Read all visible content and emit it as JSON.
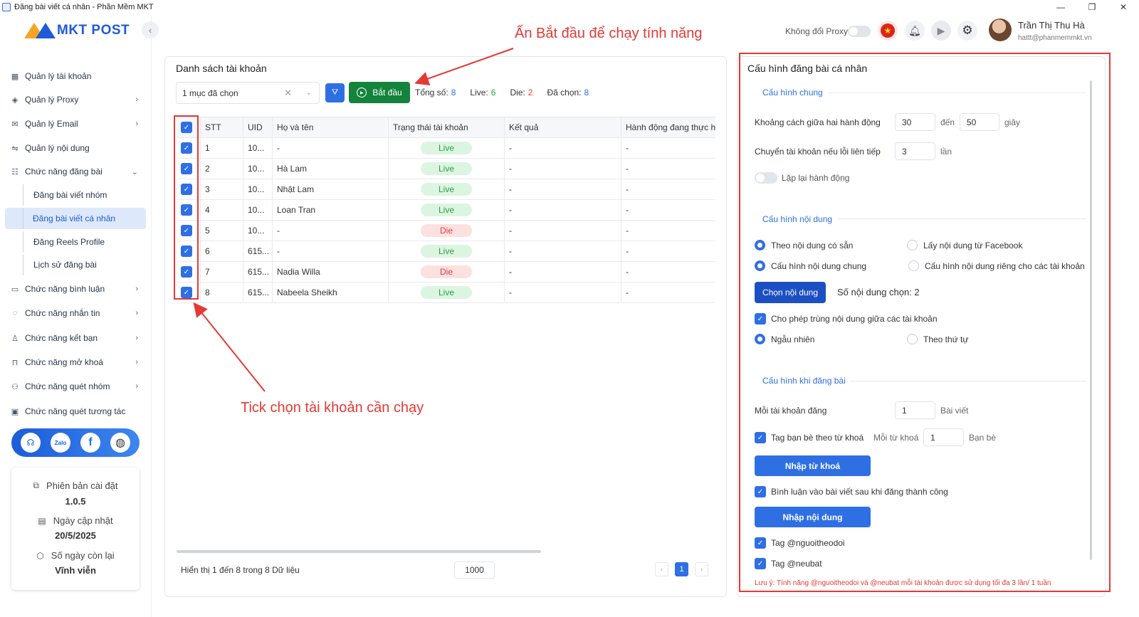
{
  "window": {
    "title": "Đăng bài viết cá nhân - Phần Mềm MKT",
    "minimize": "—",
    "restore": "❐",
    "close": "✕"
  },
  "logo": {
    "text": "MKT POST"
  },
  "sidebar": {
    "items": [
      {
        "label": "Quản lý tài khoản",
        "icon": "grid-icon"
      },
      {
        "label": "Quản lý Proxy",
        "icon": "layers-icon"
      },
      {
        "label": "Quản lý Email",
        "icon": "mail-icon"
      },
      {
        "label": "Quản lý nội dung",
        "icon": "content-icon"
      },
      {
        "label": "Chức năng đăng bài",
        "icon": "post-icon"
      },
      {
        "label": "Chức năng bình luận",
        "icon": "comment-icon"
      },
      {
        "label": "Chức năng nhắn tin",
        "icon": "message-icon"
      },
      {
        "label": "Chức năng kết bạn",
        "icon": "add-friend-icon"
      },
      {
        "label": "Chức năng mở khoá",
        "icon": "lock-icon"
      },
      {
        "label": "Chức năng quét nhóm",
        "icon": "group-icon"
      },
      {
        "label": "Chức năng quét tương tác",
        "icon": "scan-icon"
      }
    ],
    "subitems": [
      "Đăng bài viết nhóm",
      "Đăng bài viết cá nhân",
      "Đăng Reels Profile",
      "Lịch sử đăng bài"
    ],
    "social": {
      "zalo": "Zalo",
      "facebook": "f"
    }
  },
  "info": {
    "version_label": "Phiên bản cài đặt",
    "version": "1.0.5",
    "update_label": "Ngày cập nhật",
    "update": "20/5/2025",
    "days_label": "Số ngày còn lại",
    "days": "Vĩnh viễn"
  },
  "topbar": {
    "proxy_label": "Không đổi Proxy",
    "user_name": "Trần Thị Thu Hà",
    "user_email": "hattt@phanmemmkt.vn"
  },
  "accounts": {
    "title": "Danh sách tài khoản",
    "select_value": "1 mục đã chọn",
    "start_label": "Bắt đầu",
    "stats": {
      "total_label": "Tổng số:",
      "total": "8",
      "live_label": "Live:",
      "live": "6",
      "die_label": "Die:",
      "die": "2",
      "selected_label": "Đã chọn:",
      "selected": "8"
    },
    "columns": [
      "STT",
      "UID",
      "Họ và tên",
      "Trạng thái tài khoản",
      "Kết quả",
      "Hành động đang thực h"
    ],
    "rows": [
      {
        "stt": "1",
        "uid": "10...",
        "name": "-",
        "status": "Live",
        "result": "-",
        "action": "-"
      },
      {
        "stt": "2",
        "uid": "10...",
        "name": "Hà Lam",
        "status": "Live",
        "result": "-",
        "action": "-"
      },
      {
        "stt": "3",
        "uid": "10...",
        "name": "Nhật Lam",
        "status": "Live",
        "result": "-",
        "action": "-"
      },
      {
        "stt": "4",
        "uid": "10...",
        "name": "Loan Tran",
        "status": "Live",
        "result": "-",
        "action": "-"
      },
      {
        "stt": "5",
        "uid": "10...",
        "name": "-",
        "status": "Die",
        "result": "-",
        "action": "-"
      },
      {
        "stt": "6",
        "uid": "615...",
        "name": "-",
        "status": "Live",
        "result": "-",
        "action": "-"
      },
      {
        "stt": "7",
        "uid": "615...",
        "name": "Nadia Willa",
        "status": "Die",
        "result": "-",
        "action": "-"
      },
      {
        "stt": "8",
        "uid": "615...",
        "name": "Nabeela Sheikh",
        "status": "Live",
        "result": "-",
        "action": "-"
      }
    ],
    "footer": "Hiển thị 1 đến 8 trong 8 Dữ liệu",
    "page_size": "1000",
    "page": "1",
    "prev": "‹",
    "next": "›"
  },
  "config": {
    "title": "Cấu hình đăng bài cá nhân",
    "general": {
      "title": "Cấu hình chung",
      "delay_label": "Khoảng cách giữa hai hành động",
      "delay_from": "30",
      "to_label": "đến",
      "delay_to": "50",
      "sec_label": "giây",
      "switch_label": "Chuyển tài khoản nếu lỗi liên tiếp",
      "switch_value": "3",
      "times_label": "lần",
      "repeat_label": "Lặp lại hành động"
    },
    "content": {
      "title": "Cấu hình nội dung",
      "opt_available": "Theo nội dung có sẵn",
      "opt_facebook": "Lấy nội dung từ Facebook",
      "opt_common": "Cấu hình nội dung chung",
      "opt_separate": "Cấu hình nội dung riêng cho các tài khoản",
      "choose_btn": "Chọn nội dung",
      "chosen_count": "Số nội dung chọn: 2",
      "allow_dup": "Cho phép trùng nội dung giữa các tài khoản",
      "opt_random": "Ngẫu nhiên",
      "opt_order": "Theo thứ tự"
    },
    "posting": {
      "title": "Cấu hình khi đăng bài",
      "per_account_label": "Mỗi tài khoản đăng",
      "per_account": "1",
      "posts_label": "Bài viết",
      "tag_friends": "Tag bạn bè theo từ khoá",
      "per_keyword_label": "Mỗi từ khoá",
      "per_keyword": "1",
      "friends_label": "Bạn bè",
      "import_keywords": "Nhập từ khoá",
      "comment_after": "Bình luận vào bài viết sau khi đăng thành công",
      "import_content": "Nhập nội dung",
      "tag_followers": "Tag @nguoitheodoi",
      "tag_everyone": "Tag @neubat"
    },
    "note": "Lưu ý: Tính năng @nguoitheodoi và @neubat mỗi tài khoản được sử dụng tối đa 3 lần/ 1 tuần"
  },
  "annotations": {
    "start_hint": "Ấn Bắt đầu để chạy tính năng",
    "tick_hint": "Tick chọn tài khoản cần chạy"
  },
  "colors": {
    "accent": "#2f6fe4",
    "start": "#14833b",
    "annotation": "#e53935",
    "live": "#27a04a",
    "die": "#e43a3a"
  }
}
